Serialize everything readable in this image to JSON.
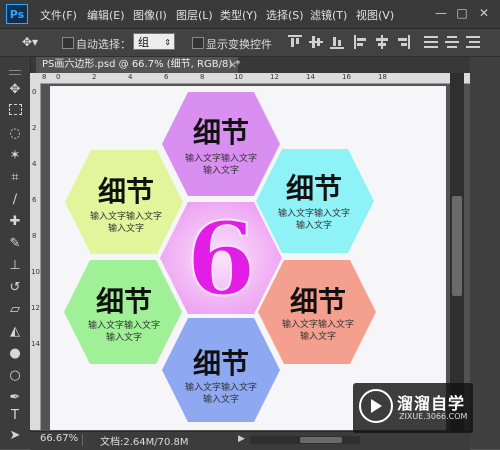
{
  "app": {
    "logo": "Ps"
  },
  "menu": {
    "items": [
      "文件(F)",
      "编辑(E)",
      "图像(I)",
      "图层(L)",
      "类型(Y)",
      "选择(S)",
      "滤镜(T)",
      "视图(V)"
    ],
    "window_buttons": [
      "—",
      "□",
      "✕"
    ]
  },
  "options_bar": {
    "tool_icon": "move-tool-icon",
    "auto_select_label": "自动选择：",
    "auto_select_value": "组",
    "show_transform_label": "显示变换控件"
  },
  "document": {
    "tab_title": "PS画六边形.psd @ 66.7% (细节, RGB/8) *",
    "close": "×"
  },
  "rulers": {
    "top": [
      "8",
      "0",
      "2",
      "4",
      "6",
      "8",
      "10",
      "12",
      "14",
      "16",
      "18"
    ],
    "left": [
      "0",
      "2",
      "4",
      "6",
      "8",
      "10",
      "12",
      "14"
    ]
  },
  "artwork": {
    "center_number": "6",
    "hexagons": [
      {
        "title": "细节",
        "line1": "输入文字输入文字",
        "line2": "输入文字",
        "color": "#d98ff0"
      },
      {
        "title": "细节",
        "line1": "输入文字输入文字",
        "line2": "输入文字",
        "color": "#8ff2f6"
      },
      {
        "title": "细节",
        "line1": "输入文字输入文字",
        "line2": "输入文字",
        "color": "#f5a08f"
      },
      {
        "title": "细节",
        "line1": "输入文字输入文字",
        "line2": "输入文字",
        "color": "#8ea8f2"
      },
      {
        "title": "细节",
        "line1": "输入文字输入文字",
        "line2": "输入文字",
        "color": "#9ff097"
      },
      {
        "title": "细节",
        "line1": "输入文字输入文字",
        "line2": "输入文字",
        "color": "#e2f59a"
      }
    ],
    "center_color": "#f4b8f6"
  },
  "status": {
    "zoom": "66.67%",
    "doc_info": "文档:2.64M/70.8M"
  },
  "watermark": {
    "title": "溜溜自学",
    "url": "ZIXUE.3066.COM"
  }
}
